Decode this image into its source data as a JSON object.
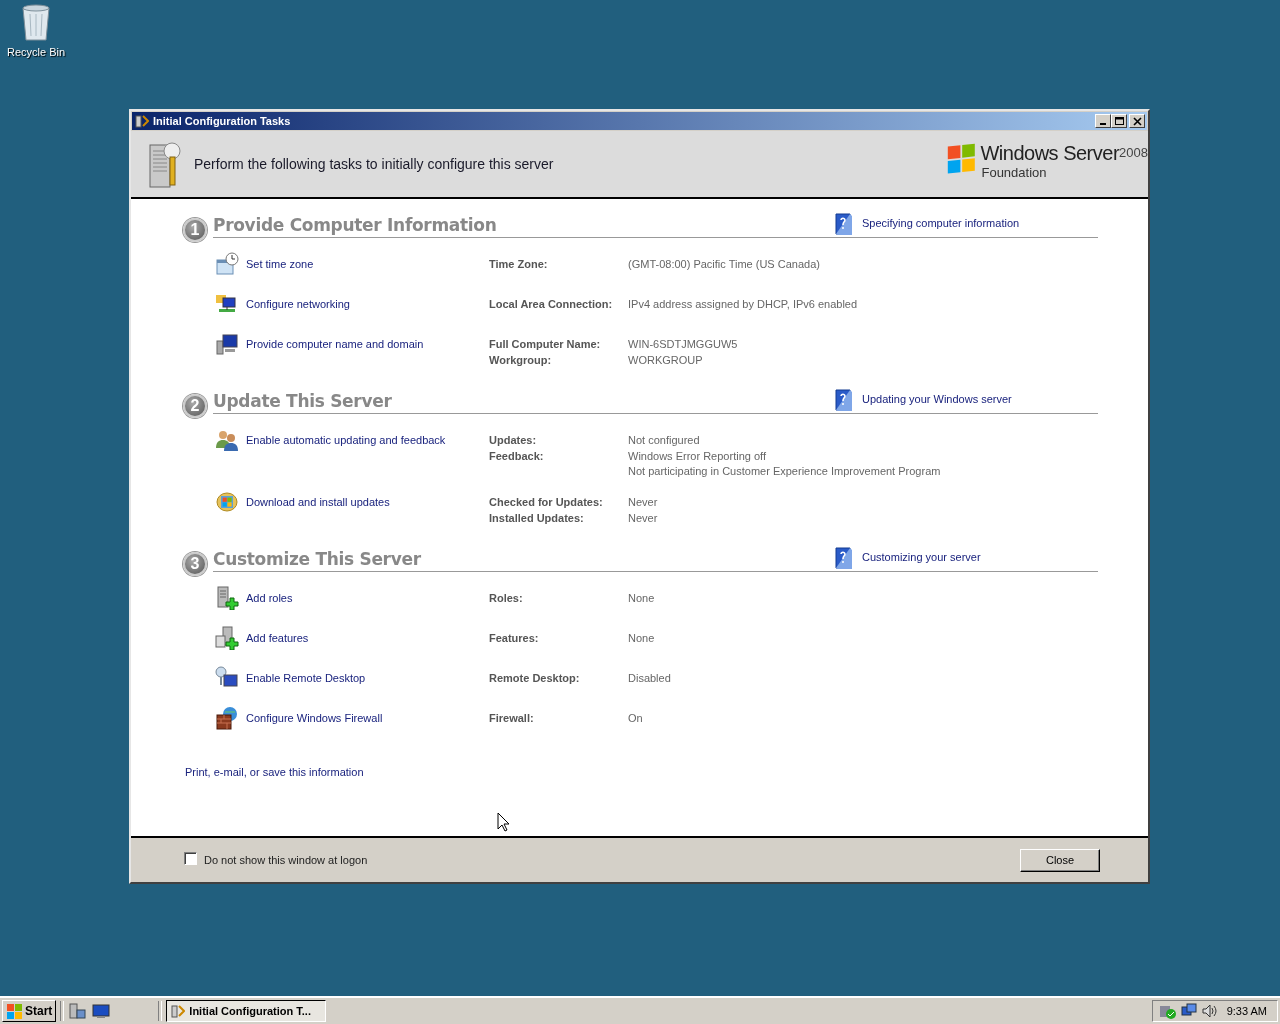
{
  "desktop_icons": [
    {
      "label": "Recycle Bin"
    }
  ],
  "window": {
    "title": "Initial Configuration Tasks",
    "header": "Perform the following tasks to initially configure this server",
    "brand": {
      "name": "Windows Server",
      "version": "2008",
      "edition": "Foundation"
    },
    "sections": [
      {
        "number": "1",
        "title": "Provide Computer Information",
        "help_link": "Specifying computer information",
        "tasks": [
          {
            "kind": "clock",
            "link": "Set time zone",
            "details": [
              {
                "label": "Time Zone:",
                "values": [
                  "(GMT-08:00) Pacific Time (US  Canada)"
                ]
              }
            ]
          },
          {
            "kind": "network",
            "link": "Configure networking",
            "details": [
              {
                "label": "Local Area Connection:",
                "values": [
                  "IPv4 address assigned by DHCP, IPv6 enabled"
                ]
              }
            ]
          },
          {
            "kind": "computer",
            "link": "Provide computer name and domain",
            "details": [
              {
                "label": "Full Computer Name:",
                "values": [
                  "WIN-6SDTJMGGUW5"
                ]
              },
              {
                "label": "Workgroup:",
                "values": [
                  "WORKGROUP"
                ]
              }
            ]
          }
        ]
      },
      {
        "number": "2",
        "title": "Update This Server",
        "help_link": "Updating your Windows server",
        "tasks": [
          {
            "kind": "people",
            "link": "Enable automatic updating and feedback",
            "details": [
              {
                "label": "Updates:",
                "values": [
                  "Not configured"
                ]
              },
              {
                "label": "Feedback:",
                "values": [
                  "Windows Error Reporting off",
                  "Not participating in Customer Experience Improvement Program"
                ]
              }
            ]
          },
          {
            "kind": "update",
            "link": "Download and install updates",
            "details": [
              {
                "label": "Checked for Updates:",
                "values": [
                  "Never"
                ]
              },
              {
                "label": "Installed Updates:",
                "values": [
                  "Never"
                ]
              }
            ]
          }
        ]
      },
      {
        "number": "3",
        "title": "Customize This Server",
        "help_link": "Customizing your server",
        "tasks": [
          {
            "kind": "roles",
            "link": "Add roles",
            "details": [
              {
                "label": "Roles:",
                "values": [
                  "None"
                ]
              }
            ]
          },
          {
            "kind": "features",
            "link": "Add features",
            "details": [
              {
                "label": "Features:",
                "values": [
                  "None"
                ]
              }
            ]
          },
          {
            "kind": "remote",
            "link": "Enable Remote Desktop",
            "details": [
              {
                "label": "Remote Desktop:",
                "values": [
                  "Disabled"
                ]
              }
            ]
          },
          {
            "kind": "firewall",
            "link": "Configure Windows Firewall",
            "details": [
              {
                "label": "Firewall:",
                "values": [
                  "On"
                ]
              }
            ]
          }
        ]
      }
    ],
    "footer_link": "Print, e-mail, or save this information",
    "dont_show": {
      "label": "Do not show this window at logon",
      "checked": false
    },
    "close_button": "Close"
  },
  "taskbar": {
    "start": "Start",
    "tasks": [
      {
        "label": "Initial Configuration T...",
        "selected": true
      }
    ],
    "clock": "9:33 AM"
  }
}
